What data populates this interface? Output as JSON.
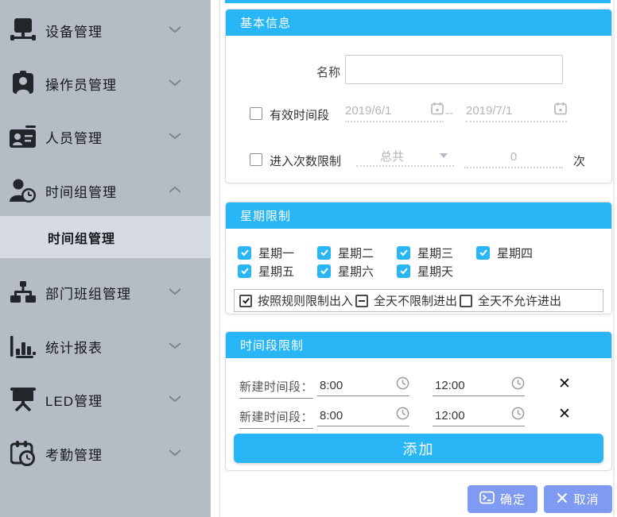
{
  "colors": {
    "accent": "#29b6f6",
    "footer_button": "#7e9bf1",
    "sidebar_bg": "#b6bcc6",
    "sidebar_active_bg": "#d5dae3"
  },
  "sidebar": {
    "items": [
      {
        "label": "设备管理",
        "icon": "device-icon",
        "state": "collapsed"
      },
      {
        "label": "操作员管理",
        "icon": "operator-icon",
        "state": "collapsed"
      },
      {
        "label": "人员管理",
        "icon": "personnel-icon",
        "state": "collapsed"
      },
      {
        "label": "时间组管理",
        "icon": "time-group-icon",
        "state": "expanded"
      },
      {
        "label": "部门班组管理",
        "icon": "department-icon",
        "state": "collapsed"
      },
      {
        "label": "统计报表",
        "icon": "stats-icon",
        "state": "collapsed"
      },
      {
        "label": "LED管理",
        "icon": "led-icon",
        "state": "collapsed"
      },
      {
        "label": "考勤管理",
        "icon": "attendance-icon",
        "state": "collapsed"
      }
    ],
    "active_submenu": "时间组管理"
  },
  "basic_info": {
    "title": "基本信息",
    "name_label": "名称",
    "name_value": "",
    "valid_period": {
      "checked": false,
      "label": "有效时间段",
      "start": "2019/6/1",
      "separator": "--",
      "end": "2019/7/1"
    },
    "entry_limit": {
      "checked": false,
      "label": "进入次数限制",
      "mode": "总共",
      "count": "0",
      "unit": "次"
    }
  },
  "week_limit": {
    "title": "星期限制",
    "days": [
      {
        "label": "星期一",
        "checked": true
      },
      {
        "label": "星期二",
        "checked": true
      },
      {
        "label": "星期三",
        "checked": true
      },
      {
        "label": "星期四",
        "checked": true
      },
      {
        "label": "星期五",
        "checked": true
      },
      {
        "label": "星期六",
        "checked": true
      },
      {
        "label": "星期天",
        "checked": true
      }
    ],
    "modes": [
      {
        "label": "按照规则限制出入",
        "state": "checked"
      },
      {
        "label": "全天不限制进出",
        "state": "indeterminate"
      },
      {
        "label": "全天不允许进出",
        "state": "unchecked"
      }
    ]
  },
  "time_limit": {
    "title": "时间段限制",
    "rows": [
      {
        "label": "新建时间段：",
        "start": "8:00",
        "end": "12:00"
      },
      {
        "label": "新建时间段：",
        "start": "8:00",
        "end": "12:00"
      }
    ],
    "add_label": "添加"
  },
  "footer": {
    "confirm_label": "确定",
    "cancel_label": "取消"
  }
}
